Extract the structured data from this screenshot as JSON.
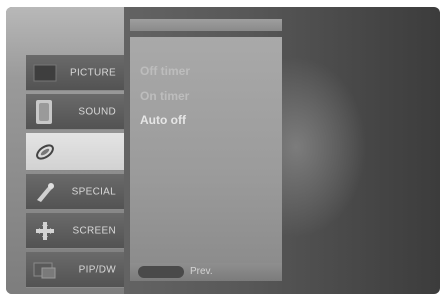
{
  "sidebar": {
    "items": [
      {
        "label": "PICTURE",
        "icon": "picture-icon"
      },
      {
        "label": "SOUND",
        "icon": "sound-icon"
      },
      {
        "label": "",
        "icon": "timer-icon"
      },
      {
        "label": "SPECIAL",
        "icon": "special-icon"
      },
      {
        "label": "SCREEN",
        "icon": "screen-icon"
      },
      {
        "label": "PIP/DW",
        "icon": "pip-icon"
      }
    ]
  },
  "submenu": {
    "items": [
      "Off timer",
      "On timer",
      "Auto off"
    ]
  },
  "footer": {
    "prev_label": "Prev."
  },
  "colors": {
    "selected_tab": "#dcdcdc",
    "tab": "#5e5e5e",
    "panel": "#a3a3a3"
  }
}
